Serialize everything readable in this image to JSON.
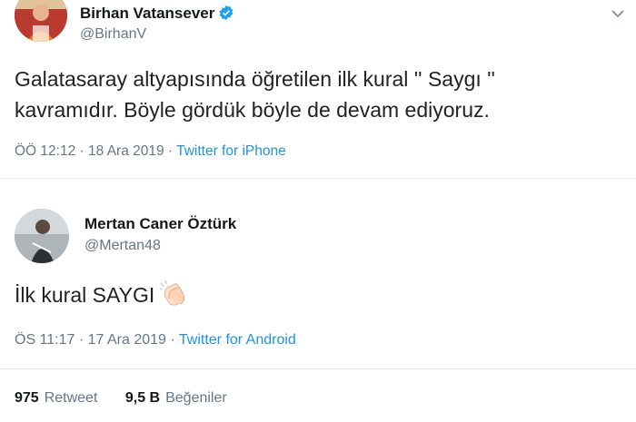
{
  "tweet1": {
    "name": "Birhan Vatansever",
    "handle": "@BirhanV",
    "verified": true,
    "text_line1": "Galatasaray altyapısında öğretilen ilk kural '' Saygı ''",
    "text_line2": "kavramıdır. Böyle gördük böyle de devam ediyoruz.",
    "time": "ÖÖ 12:12",
    "separator1": " · ",
    "date": "18 Ara 2019",
    "separator2": " · ",
    "client": "Twitter for iPhone"
  },
  "tweet2": {
    "name": "Mertan Caner Öztürk",
    "handle": "@Mertan48",
    "text": "İlk kural SAYGI",
    "emoji": "clapping-hands",
    "time": "ÖS 11:17",
    "separator1": " · ",
    "date": "17 Ara 2019",
    "separator2": " · ",
    "client": "Twitter for Android"
  },
  "stats": {
    "retweets_count": "975",
    "retweets_label": "Retweet",
    "likes_count": "9,5 B",
    "likes_label": "Beğeniler"
  },
  "colors": {
    "link": "#1b95e0",
    "muted": "#657786",
    "verified": "#1da1f2"
  },
  "icons": {
    "verified": "verified-badge-icon",
    "menu": "chevron-down-icon",
    "emoji": "clapping-hands-icon"
  }
}
